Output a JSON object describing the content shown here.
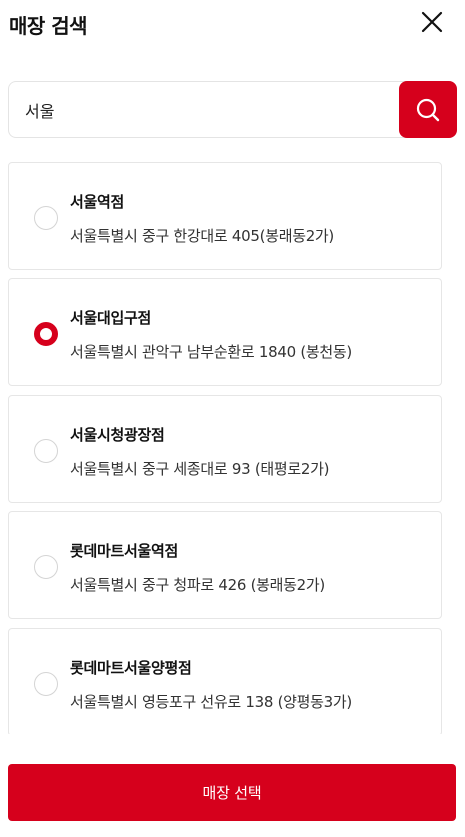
{
  "header": {
    "title": "매장 검색"
  },
  "search": {
    "value": "서울",
    "placeholder": ""
  },
  "stores": [
    {
      "name": "서울역점",
      "address": "서울특별시 중구 한강대로 405(봉래동2가)",
      "selected": false
    },
    {
      "name": "서울대입구점",
      "address": "서울특별시 관악구 남부순환로 1840 (봉천동)",
      "selected": true
    },
    {
      "name": "서울시청광장점",
      "address": "서울특별시 중구 세종대로 93 (태평로2가)",
      "selected": false
    },
    {
      "name": "롯데마트서울역점",
      "address": "서울특별시 중구 청파로 426 (봉래동2가)",
      "selected": false
    },
    {
      "name": "롯데마트서울양평점",
      "address": "서울특별시 영등포구 선유로 138 (양평동3가)",
      "selected": false
    }
  ],
  "footer": {
    "select_label": "매장 선택"
  },
  "colors": {
    "accent": "#d6001c"
  }
}
